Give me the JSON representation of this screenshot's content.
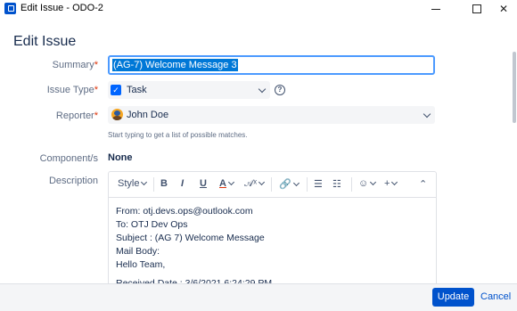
{
  "window": {
    "title": "Edit Issue - ODO-2"
  },
  "dialog": {
    "title": "Edit Issue"
  },
  "fields": {
    "summary": {
      "label": "Summary",
      "required_mark": "*",
      "value": "(AG-7) Welcome Message 3"
    },
    "issue_type": {
      "label": "Issue Type",
      "required_mark": "*",
      "value": "Task",
      "help": "?"
    },
    "reporter": {
      "label": "Reporter",
      "required_mark": "*",
      "value": "John Doe",
      "hint": "Start typing to get a list of possible matches."
    },
    "components": {
      "label": "Component/s",
      "value": "None"
    },
    "description": {
      "label": "Description",
      "toolbar": {
        "style_label": "Style",
        "bold": "B",
        "italic": "I",
        "underline": "U",
        "text_color": "A"
      },
      "lines": [
        "From: otj.devs.ops@outlook.com",
        "To: OTJ Dev Ops",
        "Subject : (AG 7) Welcome Message",
        "Mail Body:",
        "Hello Team,",
        "",
        "Received Date : 3/6/2021 6:24:29 PM"
      ]
    }
  },
  "footer": {
    "update_label": "Update",
    "cancel_label": "Cancel"
  },
  "colors": {
    "primary": "#0052cc",
    "focus": "#4c9aff",
    "required": "#de350b",
    "selection": "#0078d7"
  }
}
